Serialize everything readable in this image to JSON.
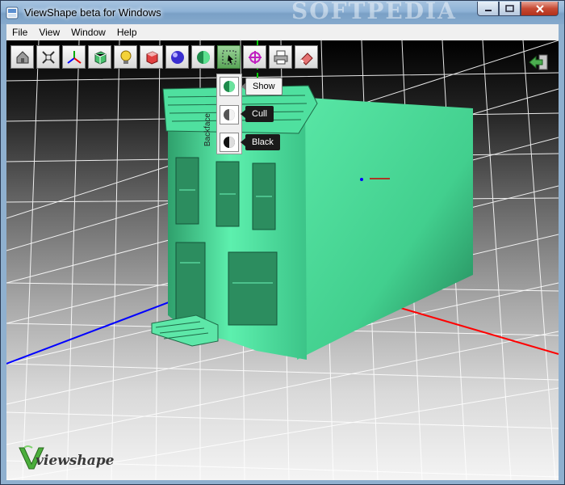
{
  "window": {
    "title": "ViewShape beta for Windows",
    "watermark": "SOFTPEDIA"
  },
  "menu": [
    "File",
    "View",
    "Window",
    "Help"
  ],
  "toolbar": {
    "tools": [
      {
        "icon": "home-icon"
      },
      {
        "icon": "fit-view-icon"
      },
      {
        "icon": "axes-icon"
      },
      {
        "icon": "wireframe-cube-icon"
      },
      {
        "icon": "light-bulb-icon"
      },
      {
        "icon": "solid-cube-icon"
      },
      {
        "icon": "material-sphere-icon"
      },
      {
        "icon": "shading-sphere-icon"
      },
      {
        "icon": "select-region-icon",
        "active": true
      },
      {
        "icon": "transform-gizmo-icon"
      },
      {
        "icon": "printer-icon"
      },
      {
        "icon": "eraser-icon"
      }
    ]
  },
  "shading_popup": {
    "tooltips": [
      "Show",
      "Cull",
      "Black"
    ],
    "side_label": "Backface"
  },
  "logo": {
    "text": "viewshape"
  },
  "colors": {
    "model": "#4fe09f",
    "axis_x": "#ff0000",
    "axis_y": "#00c800",
    "axis_z": "#0000ff"
  }
}
